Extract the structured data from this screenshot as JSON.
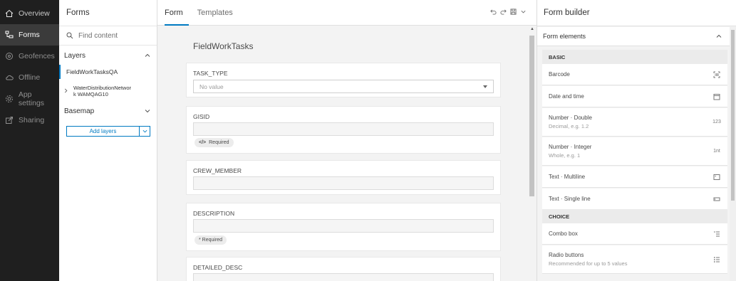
{
  "nav": {
    "items": [
      {
        "label": "Overview",
        "icon": "home-icon"
      },
      {
        "label": "Forms",
        "icon": "forms-icon"
      },
      {
        "label": "Geofences",
        "icon": "geofence-icon"
      },
      {
        "label": "Offline",
        "icon": "cloud-offline-icon"
      },
      {
        "label": "App settings",
        "icon": "gear-icon"
      },
      {
        "label": "Sharing",
        "icon": "share-icon"
      }
    ]
  },
  "layers_panel": {
    "title": "Forms",
    "search_placeholder": "Find content",
    "layers_heading": "Layers",
    "layers": [
      {
        "name": "FieldWorkTasksQA"
      },
      {
        "name_line1": "WaterDistributionNetwor",
        "name_line2": "k WAMQAG10"
      }
    ],
    "basemap_heading": "Basemap",
    "add_layers_label": "Add layers"
  },
  "center": {
    "tabs": [
      "Form",
      "Templates"
    ],
    "form_title": "FieldWorkTasks",
    "fields": [
      {
        "label": "TASK_TYPE",
        "value": "No value"
      },
      {
        "label": "GISID",
        "chip": "Required"
      },
      {
        "label": "CREW_MEMBER"
      },
      {
        "label": "DESCRIPTION",
        "chip": "* Required"
      },
      {
        "label": "DETAILED_DESC"
      }
    ]
  },
  "builder": {
    "title": "Form builder",
    "elements_heading": "Form elements",
    "categories": {
      "basic": "BASIC",
      "choice": "CHOICE"
    },
    "basic_items": [
      {
        "title": "Barcode",
        "icon": "barcode-icon"
      },
      {
        "title": "Date and time",
        "icon": "calendar-icon"
      },
      {
        "title": "Number · Double",
        "subtitle": "Decimal, e.g. 1.2",
        "icon": "123"
      },
      {
        "title": "Number · Integer",
        "subtitle": "Whole, e.g. 1",
        "icon": "1nt"
      },
      {
        "title": "Text · Multiline",
        "icon": "text-area-icon"
      },
      {
        "title": "Text · Single line",
        "icon": "text-input-icon"
      }
    ],
    "choice_items": [
      {
        "title": "Combo box",
        "icon": "list-icon"
      },
      {
        "title": "Radio buttons",
        "subtitle": "Recommended for up to 5 values",
        "icon": "radio-list-icon"
      }
    ]
  }
}
